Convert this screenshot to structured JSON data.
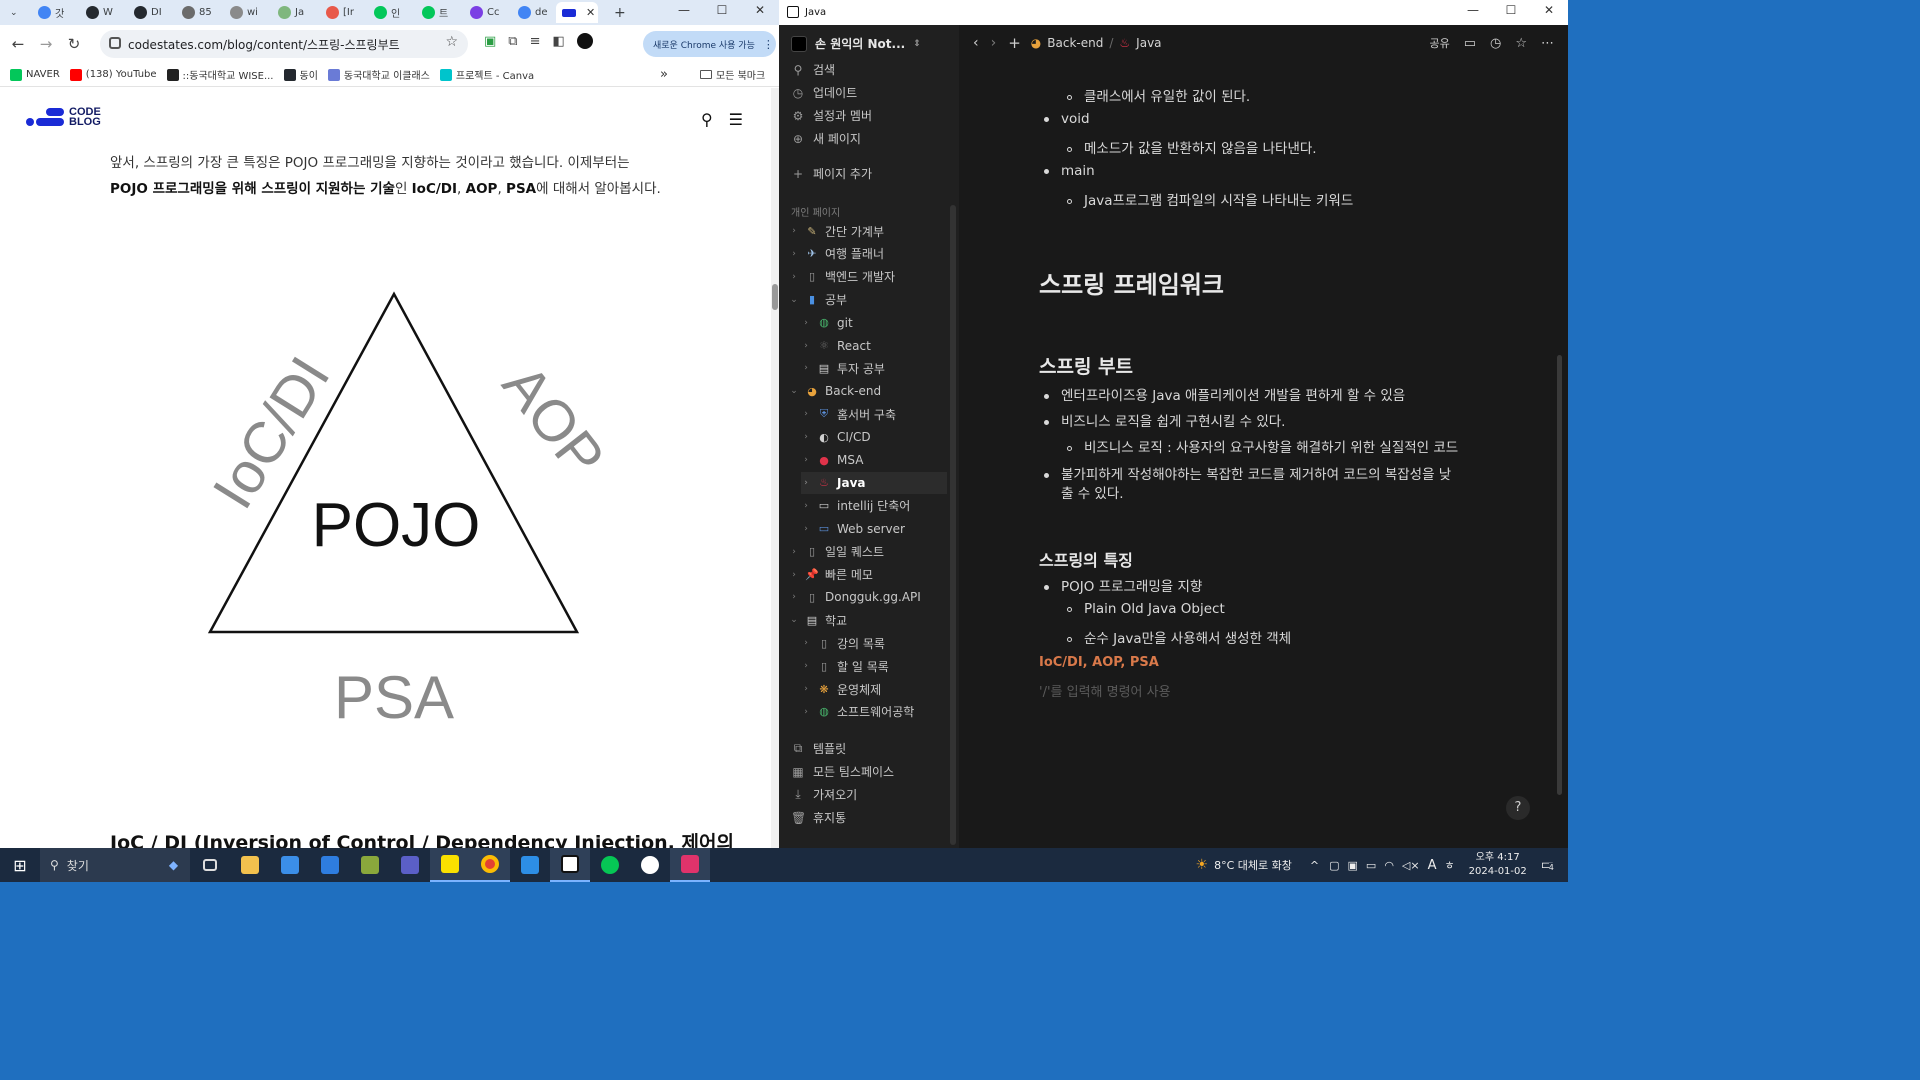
{
  "chrome": {
    "tabs": [
      {
        "label": "갓",
        "color": "#4285f4"
      },
      {
        "label": "W",
        "color": "#24292f"
      },
      {
        "label": "DI",
        "color": "#24292f"
      },
      {
        "label": "85",
        "color": "#6b6b6b"
      },
      {
        "label": "wi",
        "color": "#8a8a8a"
      },
      {
        "label": "Ja",
        "color": "#7fb77e"
      },
      {
        "label": "[Ir",
        "color": "#e8594a"
      },
      {
        "label": "인",
        "color": "#03c75a"
      },
      {
        "label": "트",
        "color": "#03c75a"
      },
      {
        "label": "Cc",
        "color": "#7b3fe4"
      },
      {
        "label": "de",
        "color": "#4285f4"
      }
    ],
    "window_buttons": [
      "—",
      "☐",
      "✕"
    ],
    "url": "codestates.com/blog/content/스프링-스프링부트",
    "update_label": "새로운 Chrome 사용 가능",
    "bookmarks": [
      {
        "label": "NAVER",
        "color": "#03c75a"
      },
      {
        "label": "(138) YouTube",
        "color": "#ff0000"
      },
      {
        "label": "::동국대학교 WISE...",
        "color": "#222"
      },
      {
        "label": "동이",
        "color": "#24292f"
      },
      {
        "label": "동국대학교 이클래스",
        "color": "#6a7bd6"
      },
      {
        "label": "프로젝트 - Canva",
        "color": "#00c4cc"
      }
    ],
    "bookmarks_more": "»",
    "all_bookmarks": "모든 북마크"
  },
  "blog": {
    "logo_line1": "CODE",
    "logo_line2": "BLOG",
    "para_line1": "앞서, 스프링의 가장 큰 특징은 POJO 프로그래밍을 지향하는 것이라고 했습니다. 이제부터는",
    "para_bold1": "POJO 프로그래밍을 위해 스프링이 지원하는 기술",
    "para_mid": "인 ",
    "para_bold2": "IoC/DI",
    "para_sep1": ", ",
    "para_bold3": "AOP",
    "para_sep2": ", ",
    "para_bold4": "PSA",
    "para_end": "에 대해서 알아봅시다.",
    "diagram": {
      "center": "POJO",
      "left": "IoC/DI",
      "right": "AOP",
      "bottom": "PSA"
    },
    "next_heading": "IoC / DI (Inversion of Control / Dependency Injection, 제어의"
  },
  "notion": {
    "window_title": "Java",
    "workspace": "손 원익의 Not...",
    "nav": [
      {
        "label": "검색",
        "icon": "search-icon",
        "glyph": "⚲"
      },
      {
        "label": "업데이트",
        "icon": "clock-icon",
        "glyph": "◷"
      },
      {
        "label": "설정과 멤버",
        "icon": "gear-icon",
        "glyph": "⚙"
      },
      {
        "label": "새 페이지",
        "icon": "plus-circle-icon",
        "glyph": "⊕"
      }
    ],
    "add_page": "페이지 추가",
    "section_label": "개인 페이지",
    "tree": [
      {
        "label": "간단 가계부",
        "glyph": "✎",
        "color": "#c9b37a",
        "depth": 0,
        "open": false
      },
      {
        "label": "여행 플래너",
        "glyph": "✈",
        "color": "#9ec1e6",
        "depth": 0,
        "open": false
      },
      {
        "label": "백엔드 개발자",
        "glyph": "▯",
        "color": "#9b9b9b",
        "depth": 0,
        "open": false
      },
      {
        "label": "공부",
        "glyph": "▮",
        "color": "#4a90e2",
        "depth": 0,
        "open": true
      },
      {
        "label": "git",
        "glyph": "◍",
        "color": "#48b36b",
        "depth": 1,
        "open": false
      },
      {
        "label": "React",
        "glyph": "⚛",
        "color": "#6b6b6b",
        "depth": 1,
        "open": false
      },
      {
        "label": "투자 공부",
        "glyph": "▤",
        "color": "#cfcfcf",
        "depth": 1,
        "open": false
      },
      {
        "label": "Back-end",
        "glyph": "◕",
        "color": "#e8a23c",
        "depth": 0,
        "open": true
      },
      {
        "label": "홈서버 구축",
        "glyph": "⛨",
        "color": "#5b8fd9",
        "depth": 1,
        "open": false
      },
      {
        "label": "CI/CD",
        "glyph": "◐",
        "color": "#cfcfcf",
        "depth": 1,
        "open": false
      },
      {
        "label": "MSA",
        "glyph": "●",
        "color": "#e0334a",
        "depth": 1,
        "open": false
      },
      {
        "label": "Java",
        "glyph": "♨",
        "color": "#e0334a",
        "depth": 1,
        "open": false,
        "active": true
      },
      {
        "label": "intellij 단축어",
        "glyph": "▭",
        "color": "#cfcfcf",
        "depth": 1,
        "open": false
      },
      {
        "label": "Web server",
        "glyph": "▭",
        "color": "#5b8fd9",
        "depth": 1,
        "open": false
      },
      {
        "label": "일일 퀘스트",
        "glyph": "▯",
        "color": "#9b9b9b",
        "depth": 0,
        "open": false
      },
      {
        "label": "빠른 메모",
        "glyph": "📌",
        "color": "#e0334a",
        "depth": 0,
        "open": false
      },
      {
        "label": "Dongguk.gg.API",
        "glyph": "▯",
        "color": "#9b9b9b",
        "depth": 0,
        "open": false
      },
      {
        "label": "학교",
        "glyph": "▤",
        "color": "#cfcfcf",
        "depth": 0,
        "open": true
      },
      {
        "label": "강의 목록",
        "glyph": "▯",
        "color": "#9b9b9b",
        "depth": 1,
        "open": false
      },
      {
        "label": "할 일 목록",
        "glyph": "▯",
        "color": "#9b9b9b",
        "depth": 1,
        "open": false
      },
      {
        "label": "운영체제",
        "glyph": "❋",
        "color": "#e8a23c",
        "depth": 1,
        "open": false
      },
      {
        "label": "소프트웨어공학",
        "glyph": "◍",
        "color": "#48b36b",
        "depth": 1,
        "open": false
      }
    ],
    "bottom_nav": [
      {
        "label": "템플릿",
        "icon": "template-icon",
        "glyph": "⧉"
      },
      {
        "label": "모든 팀스페이스",
        "icon": "teamspace-icon",
        "glyph": "▦"
      },
      {
        "label": "가져오기",
        "icon": "import-icon",
        "glyph": "⤓"
      },
      {
        "label": "휴지통",
        "icon": "trash-icon",
        "glyph": "🗑"
      }
    ],
    "breadcrumb": {
      "parent": "Back-end",
      "sep": "/",
      "current": "Java"
    },
    "share": "공유",
    "doc": {
      "l1": "클래스에서 유일한 값이 된다.",
      "l2": "void",
      "l3": "메소드가 값을 반환하지 않음을 나타낸다.",
      "l4": "main",
      "l5": "Java프로그램 컴파일의 시작을 나타내는 키워드",
      "h1": "스프링 프레임워크",
      "h2": "스프링 부트",
      "b1": "엔터프라이즈용 Java 애플리케이션 개발을 편하게 할 수 있음",
      "b2": "비즈니스 로직을 쉽게 구현시킬 수 있다.",
      "b2a": "비즈니스 로직 : 사용자의 요구사항을 해결하기 위한 실질적인 코드",
      "b3a": "불가피하게 작성해야하는 복잡한 코드를 제거하여 코드의 복잡성을 낮",
      "b3b": "출 수 있다.",
      "h3": "스프링의 특징",
      "c1": "POJO 프로그래밍을 지향",
      "c1a": "Plain Old Java Object",
      "c1b": "순수 Java만을 사용해서 생성한 객체",
      "accent": "IoC/DI, AOP, PSA",
      "placeholder": "'/'를 입력해 명령어 사용"
    },
    "help": "?"
  },
  "taskbar": {
    "search": "찾기",
    "weather": "8°C  대체로 화창",
    "time": "오후 4:17",
    "date": "2024-01-02",
    "notif_count": "4",
    "ime": "A",
    "ime2": "ㅎ"
  }
}
